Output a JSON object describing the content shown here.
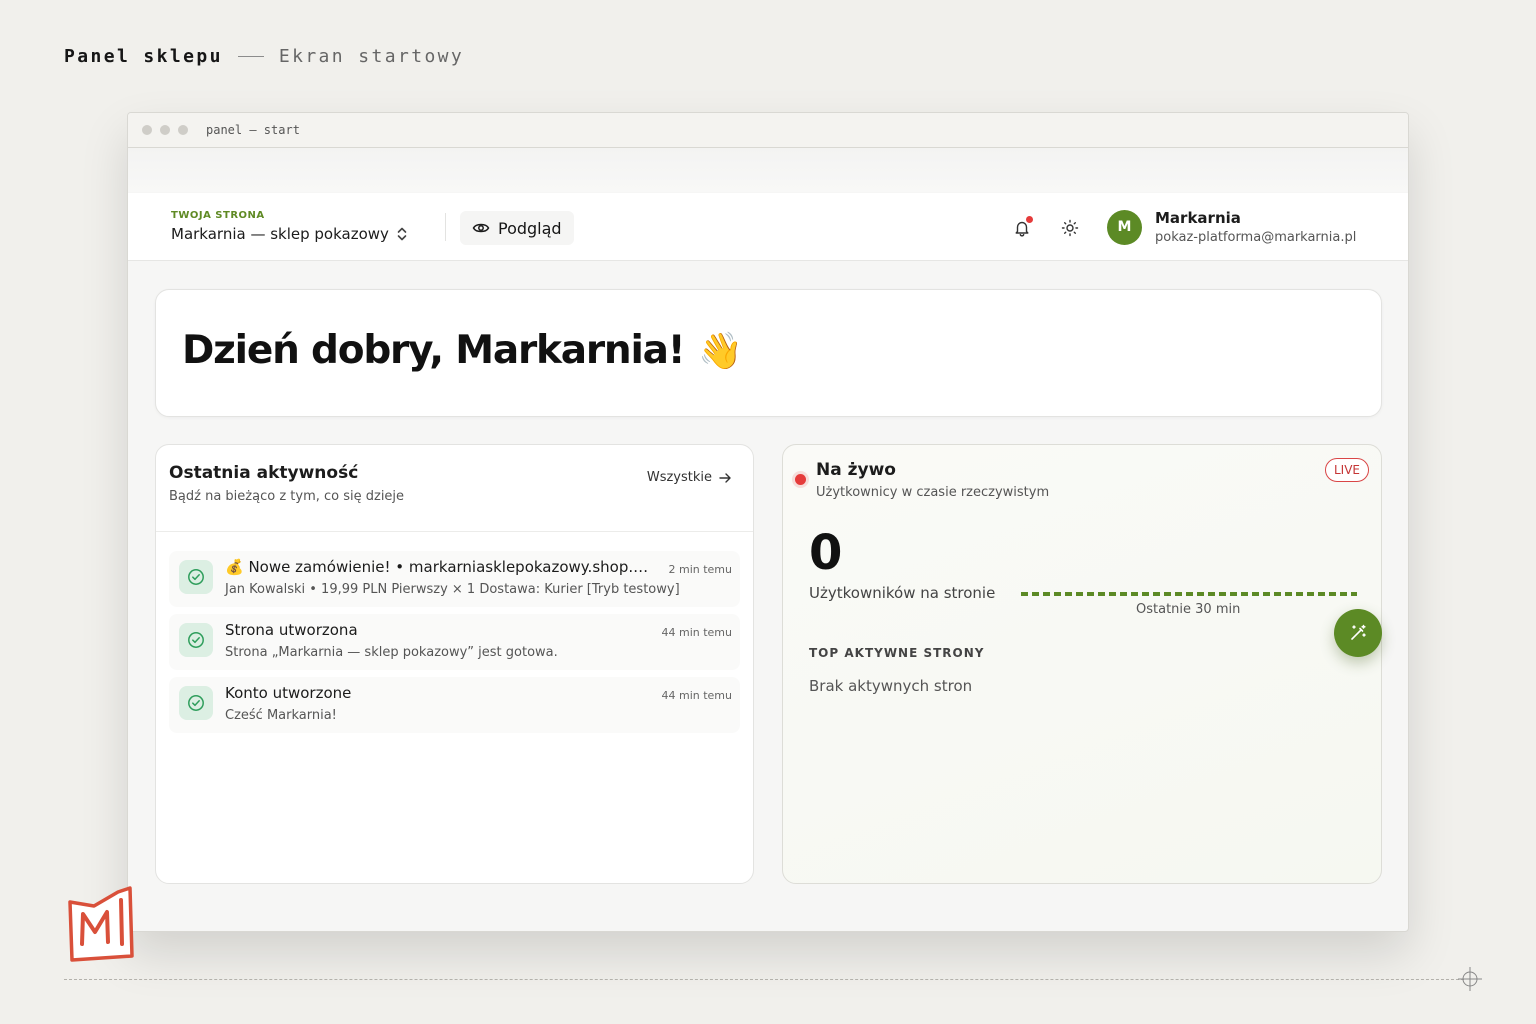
{
  "page": {
    "title": "Panel sklepu",
    "subtitle": "Ekran startowy"
  },
  "window": {
    "title": "panel — start"
  },
  "topbar": {
    "site_label": "TWOJA STRONA",
    "site_name": "Markarnia — sklep pokazowy",
    "preview_label": "Podgląd",
    "user": {
      "initial": "M",
      "name": "Markarnia",
      "email": "pokaz-platforma@markarnia.pl"
    }
  },
  "welcome": {
    "greeting": "Dzień dobry, Markarnia!",
    "emoji": "👋"
  },
  "activity": {
    "title": "Ostatnia aktywność",
    "subtitle": "Bądź na bieżąco z tym, co się dzieje",
    "see_all": "Wszystkie",
    "items": [
      {
        "title": "💰 Nowe zamówienie! • markarniasklepokazowy.shop.…",
        "desc": "Jan Kowalski • 19,99 PLN Pierwszy × 1 Dostawa: Kurier [Tryb testowy]",
        "time": "2 min temu"
      },
      {
        "title": "Strona utworzona",
        "desc": "Strona „Markarnia — sklep pokazowy” jest gotowa.",
        "time": "44 min temu"
      },
      {
        "title": "Konto utworzone",
        "desc": "Cześć Markarnia!",
        "time": "44 min temu"
      }
    ]
  },
  "live": {
    "title": "Na żywo",
    "subtitle": "Użytkownicy w czasie rzeczywistym",
    "badge": "LIVE",
    "count": "0",
    "count_label": "Użytkowników na stronie",
    "range_label": "Ostatnie 30 min",
    "top_title": "TOP AKTYWNE STRONY",
    "top_empty": "Brak aktywnych stron",
    "series_minutes": 30,
    "series_values": [
      0,
      0,
      0,
      0,
      0,
      0,
      0,
      0,
      0,
      0,
      0,
      0,
      0,
      0,
      0,
      0,
      0,
      0,
      0,
      0,
      0,
      0,
      0,
      0,
      0,
      0,
      0,
      0,
      0,
      0
    ]
  },
  "colors": {
    "accent": "#5c8a25",
    "live_red": "#e53b3b",
    "success_bg": "#dcefe3",
    "success_icon": "#2f9e5c",
    "logo": "#d9503a"
  },
  "icons": {
    "site_selector": "chevron-up-down-icon",
    "preview": "eye-icon",
    "notifications": "bell-icon",
    "theme": "sun-icon",
    "activity_item": "check-circle-icon",
    "see_all": "arrow-right-icon",
    "fab": "magic-wand-icon"
  }
}
